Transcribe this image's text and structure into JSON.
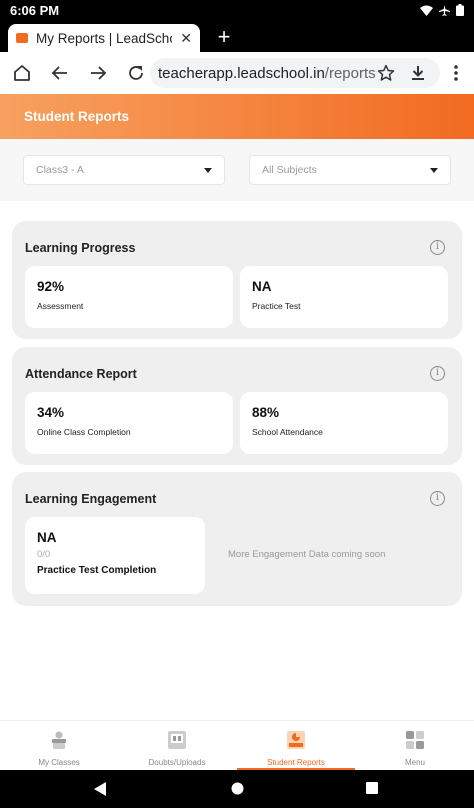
{
  "status_bar": {
    "time": "6:06 PM"
  },
  "browser": {
    "tab_title": "My Reports | LeadSchool",
    "url_domain": "teacherapp.leadschool.in",
    "url_path": "/reports"
  },
  "header": {
    "title": "Student Reports"
  },
  "filters": {
    "class_value": "Class3 - A",
    "subject_value": "All Subjects"
  },
  "learning_progress": {
    "title": "Learning Progress",
    "cards": [
      {
        "value": "92%",
        "label": "Assessment"
      },
      {
        "value": "NA",
        "label": "Practice Test"
      }
    ]
  },
  "attendance_report": {
    "title": "Attendance Report",
    "cards": [
      {
        "value": "34%",
        "label": "Online Class Completion"
      },
      {
        "value": "88%",
        "label": "School Attendance"
      }
    ]
  },
  "learning_engagement": {
    "title": "Learning Engagement",
    "card": {
      "value": "NA",
      "sub": "0/0",
      "label": "Practice Test Completion"
    },
    "coming_soon": "More Engagement Data coming soon"
  },
  "bottom_nav": {
    "items": [
      {
        "label": "My Classes"
      },
      {
        "label": "Doubts/Uploads"
      },
      {
        "label": "Student Reports"
      },
      {
        "label": "Menu"
      }
    ],
    "active_index": 2
  },
  "colors": {
    "accent": "#f26b21",
    "header_gradient_start": "#f7a160",
    "panel_bg": "#efefef"
  }
}
